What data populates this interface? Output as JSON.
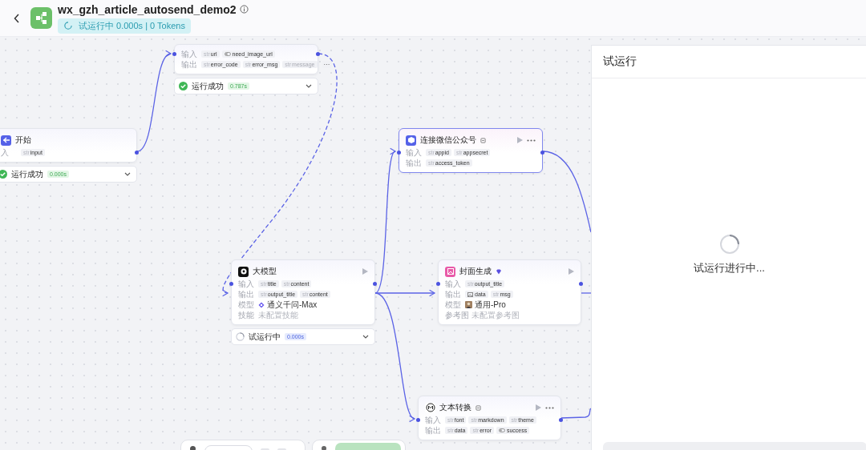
{
  "header": {
    "title": "wx_gzh_article_autosend_demo2",
    "status_badge": "试运行中 0.000s | 0 Tokens"
  },
  "nodes": [
    {
      "selected": false,
      "rows": [
        {
          "kind": "ports",
          "label": "输入",
          "tags": [
            {
              "kind": "text",
              "prefix": "str",
              "name": "url"
            },
            {
              "kind": "bool",
              "name": "need_image_url"
            }
          ]
        },
        {
          "kind": "ports",
          "label": "输出",
          "tags": [
            {
              "kind": "text",
              "prefix": "str",
              "name": "error_code"
            },
            {
              "kind": "text",
              "prefix": "str",
              "name": "error_msg"
            },
            {
              "kind": "text",
              "prefix": "str",
              "name": "message"
            }
          ],
          "more": "···"
        }
      ],
      "status": {
        "kind": "success",
        "text": "运行成功",
        "time": "0.787s"
      }
    },
    {
      "title": "开始",
      "kind": "start",
      "runnable": false,
      "menu": false,
      "selected": false,
      "rows": [
        {
          "kind": "ports",
          "label": "入",
          "tags": [
            {
              "kind": "text",
              "prefix": "str",
              "name": "input"
            }
          ]
        }
      ],
      "status": {
        "kind": "success",
        "text": "运行成功",
        "time": "0.000s"
      }
    },
    {
      "title": "连接微信公众号",
      "kind": "wechat",
      "runnable": true,
      "menu": true,
      "selected": true,
      "rows": [
        {
          "kind": "ports",
          "label": "输入",
          "tags": [
            {
              "kind": "text",
              "prefix": "str",
              "name": "appid"
            },
            {
              "kind": "text",
              "prefix": "str",
              "name": "appsecret"
            }
          ]
        },
        {
          "kind": "ports",
          "label": "输出",
          "tags": [
            {
              "kind": "text",
              "prefix": "str",
              "name": "access_token"
            }
          ]
        }
      ]
    },
    {
      "title": "大模型",
      "kind": "llm",
      "runnable": true,
      "menu": false,
      "selected": false,
      "rows": [
        {
          "kind": "ports",
          "label": "输入",
          "tags": [
            {
              "kind": "text",
              "prefix": "str",
              "name": "title"
            },
            {
              "kind": "text",
              "prefix": "str",
              "name": "content"
            }
          ]
        },
        {
          "kind": "ports",
          "label": "输出",
          "tags": [
            {
              "kind": "text",
              "prefix": "str",
              "name": "output_title"
            },
            {
              "kind": "text",
              "prefix": "str",
              "name": "content"
            }
          ]
        },
        {
          "kind": "model",
          "label": "模型",
          "value": "通义千问-Max"
        },
        {
          "kind": "text",
          "label": "技能",
          "value": "未配置技能"
        }
      ],
      "status": {
        "kind": "running",
        "text": "试运行中",
        "time": "0.000s"
      }
    },
    {
      "title": "封面生成",
      "kind": "image",
      "runnable": true,
      "menu": false,
      "selected": false,
      "rows": [
        {
          "kind": "ports",
          "label": "输入",
          "tags": [
            {
              "kind": "text",
              "prefix": "str",
              "name": "output_title"
            }
          ]
        },
        {
          "kind": "ports",
          "label": "输出",
          "tags": [
            {
              "kind": "image",
              "name": "data"
            },
            {
              "kind": "text",
              "prefix": "str",
              "name": "msg"
            }
          ]
        },
        {
          "kind": "model",
          "label": "模型",
          "value": "通用-Pro"
        },
        {
          "kind": "text",
          "label": "参考图",
          "value": "未配置参考图"
        }
      ]
    },
    {
      "title": "文本转换",
      "kind": "markdown",
      "runnable": true,
      "menu": true,
      "selected": false,
      "rows": [
        {
          "kind": "ports",
          "label": "输入",
          "tags": [
            {
              "kind": "text",
              "prefix": "str",
              "name": "font"
            },
            {
              "kind": "text",
              "prefix": "str",
              "name": "markdown"
            },
            {
              "kind": "text",
              "prefix": "str",
              "name": "theme"
            }
          ]
        },
        {
          "kind": "ports",
          "label": "输出",
          "tags": [
            {
              "kind": "text",
              "prefix": "str",
              "name": "data"
            },
            {
              "kind": "text",
              "prefix": "str",
              "name": "error"
            },
            {
              "kind": "bool",
              "name": "success"
            }
          ]
        }
      ]
    }
  ],
  "panel": {
    "title": "试运行",
    "message": "试运行进行中..."
  }
}
